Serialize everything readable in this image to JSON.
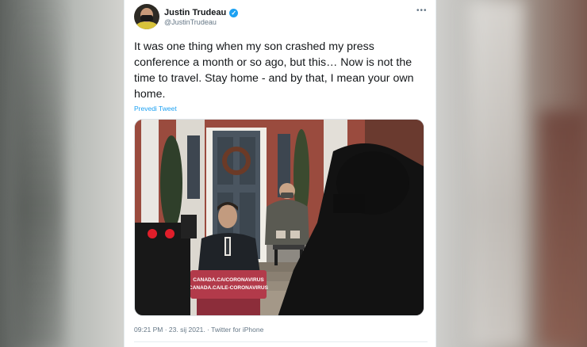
{
  "tweet": {
    "display_name": "Justin Trudeau",
    "handle": "@JustinTrudeau",
    "verified_icon": "verified-badge-icon",
    "more_icon": "more-options-icon",
    "more_label": "•••",
    "text": "It was one thing when my son crashed my press conference a month or so ago, but this… Now is not the time to travel. Stay home - and by that, I mean your own home.",
    "translate_label": "Prevedi Tweet",
    "meta": "09:21 PM · 23. sij 2021. · Twitter for iPhone"
  },
  "photo": {
    "podium_line1": "CANADA.CA/CORONAVIRUS",
    "podium_line2": "CANADA.CA/LE-CORONAVIRUS"
  },
  "colors": {
    "accent": "#1da1f2",
    "text": "#14171a",
    "muted": "#657786",
    "podium": "#b23a4a"
  }
}
